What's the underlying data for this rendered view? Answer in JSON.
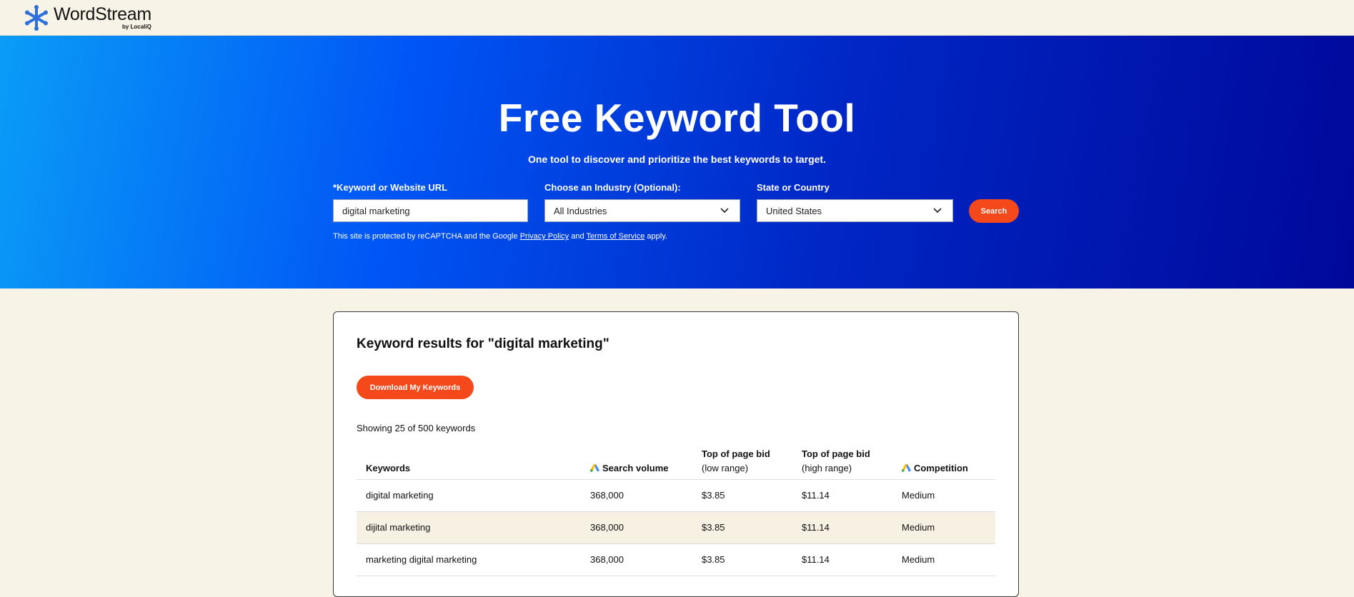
{
  "brand": {
    "name": "WordStream",
    "sub": "by LocaliQ",
    "color": "#2f6fdc"
  },
  "hero": {
    "title": "Free Keyword Tool",
    "subtitle": "One tool to discover and prioritize the best keywords to target.",
    "keyword_label": "*Keyword or Website URL",
    "keyword_value": "digital marketing",
    "industry_label": "Choose an Industry (Optional):",
    "industry_value": "All Industries",
    "location_label": "State or Country",
    "location_value": "United States",
    "search_button": "Search",
    "recaptcha_prefix": "This site is protected by reCAPTCHA and the Google",
    "privacy_link": "Privacy Policy",
    "and_text": "and",
    "terms_link": "Terms of Service",
    "recaptcha_suffix": "apply."
  },
  "results": {
    "title": "Keyword results for \"digital marketing\"",
    "download_button": "Download My Keywords",
    "showing": "Showing 25 of 500 keywords",
    "columns": {
      "keywords": "Keywords",
      "search_volume": "Search volume",
      "top_bid_low": "Top of page bid",
      "top_bid_low_sub": "(low range)",
      "top_bid_high": "Top of page bid",
      "top_bid_high_sub": "(high range)",
      "competition": "Competition"
    },
    "rows": [
      {
        "keyword": "digital marketing",
        "volume": "368,000",
        "low": "$3.85",
        "high": "$11.14",
        "competition": "Medium"
      },
      {
        "keyword": "dijital marketing",
        "volume": "368,000",
        "low": "$3.85",
        "high": "$11.14",
        "competition": "Medium"
      },
      {
        "keyword": "marketing digital marketing",
        "volume": "368,000",
        "low": "$3.85",
        "high": "$11.14",
        "competition": "Medium"
      }
    ]
  },
  "colors": {
    "accent": "#f5481b",
    "hero_start": "#0a9cf7",
    "hero_end": "#00089a",
    "page_bg": "#f8f3e7"
  },
  "icons": {
    "logo": "wordstream-snowflake-icon",
    "chevron": "chevron-down-icon",
    "google_ads": "google-ads-icon"
  }
}
